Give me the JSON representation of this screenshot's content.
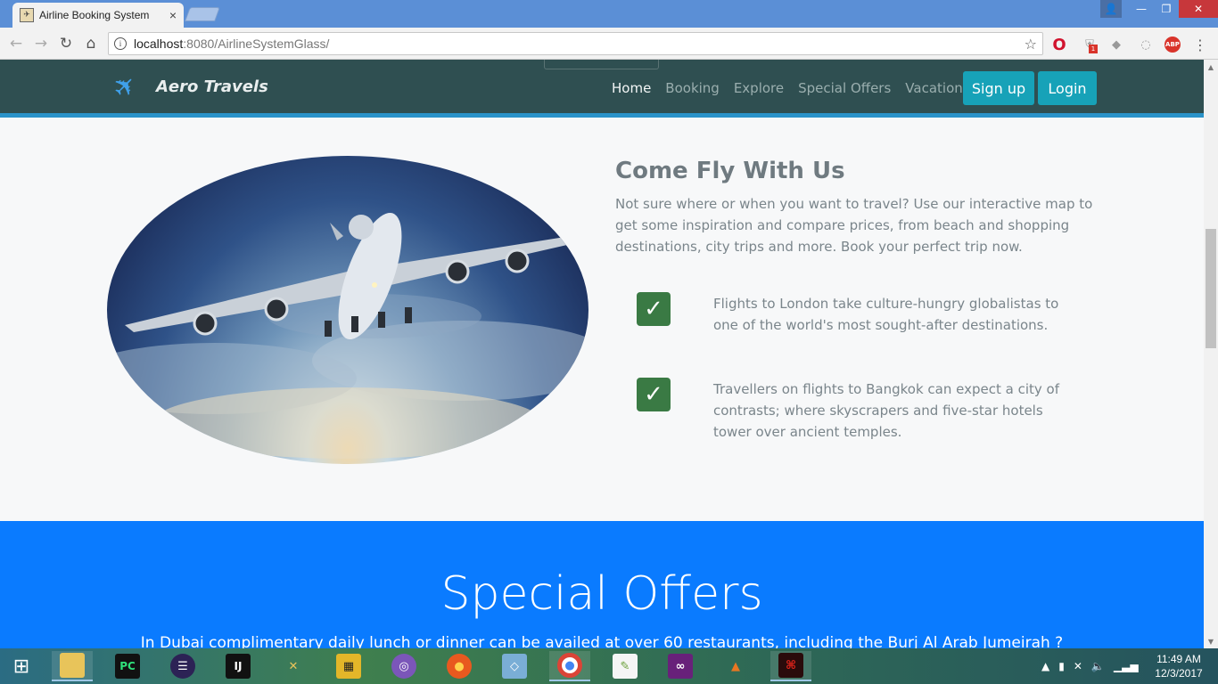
{
  "browser": {
    "tab_title": "Airline Booking System",
    "tab_close": "×",
    "url_host": "localhost",
    "url_rest": ":8080/AirlineSystemGlass/",
    "shield_badge": "1",
    "abp_label": "ABP"
  },
  "site": {
    "brand_name": "Aero Travels",
    "nav": {
      "home": "Home",
      "booking": "Booking",
      "explore": "Explore",
      "special_offers": "Special Offers",
      "vacations": "Vacations"
    },
    "signup_label": "Sign up",
    "login_label": "Login",
    "hero": {
      "heading": "Come Fly With Us",
      "intro": "Not sure where or when you want to travel? Use our interactive map to get some inspiration and compare prices, from beach and shopping destinations, city trips and more. Book your perfect trip now.",
      "features": [
        "Flights to London take culture-hungry globalistas to one of the world's most sought-after destinations.",
        "Travellers on flights to Bangkok can expect a city of contrasts; where skyscrapers and five-star hotels tower over ancient temples."
      ]
    },
    "offers": {
      "title": "Special Offers",
      "text": "In Dubai complimentary daily lunch or dinner can be availed at over 60 restaurants, including the Burj Al Arab Jumeirah ?"
    }
  },
  "taskbar": {
    "time": "11:49 AM",
    "date": "12/3/2017"
  },
  "colors": {
    "navbar": "#2f4f51",
    "accent_button": "#17a2b8",
    "offers_bg": "#0a7bff",
    "check_bg": "#3a7a44"
  },
  "icons": [
    "airplane-icon",
    "check-icon",
    "info-icon",
    "star-icon",
    "windows-start-icon"
  ]
}
